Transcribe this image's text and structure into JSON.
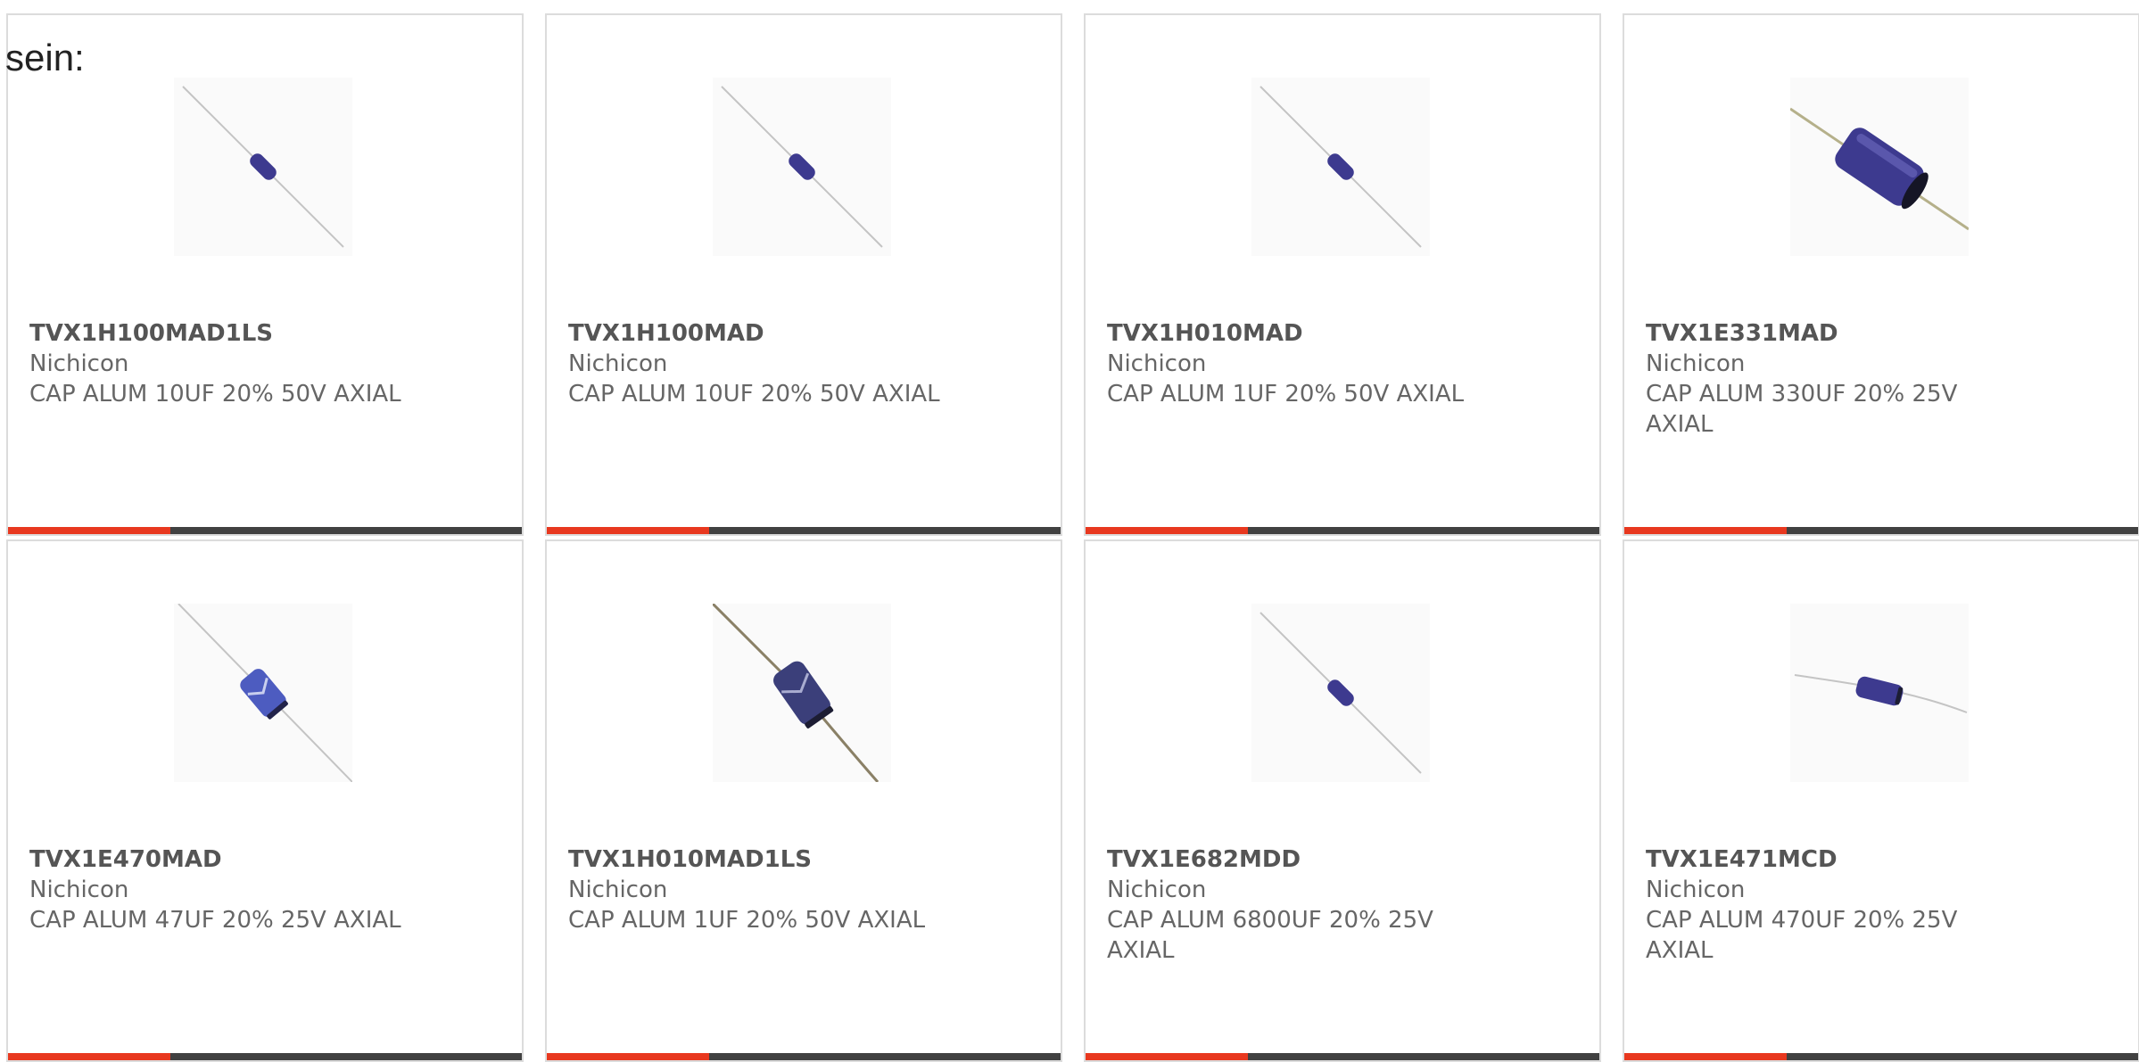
{
  "intro": {
    "text": "sein:"
  },
  "colors": {
    "accent": "#e8381f",
    "bar": "#414141",
    "border": "#dcdcdc",
    "capacitor": "#3d3a8f"
  },
  "products": [
    {
      "part_number": "TVX1H100MAD1LS",
      "manufacturer": "Nichicon",
      "description": "CAP ALUM 10UF 20% 50V AXIAL",
      "image": "capacitor-small-icon"
    },
    {
      "part_number": "TVX1H100MAD",
      "manufacturer": "Nichicon",
      "description": "CAP ALUM 10UF 20% 50V AXIAL",
      "image": "capacitor-small-icon"
    },
    {
      "part_number": "TVX1H010MAD",
      "manufacturer": "Nichicon",
      "description": "CAP ALUM 1UF 20% 50V AXIAL",
      "image": "capacitor-small-icon"
    },
    {
      "part_number": "TVX1E331MAD",
      "manufacturer": "Nichicon",
      "description": "CAP ALUM 330UF 20% 25V AXIAL",
      "image": "capacitor-large-icon"
    },
    {
      "part_number": "TVX1E470MAD",
      "manufacturer": "Nichicon",
      "description": "CAP ALUM 47UF 20% 25V AXIAL",
      "image": "capacitor-sleeved-icon"
    },
    {
      "part_number": "TVX1H010MAD1LS",
      "manufacturer": "Nichicon",
      "description": "CAP ALUM 1UF 20% 50V AXIAL",
      "image": "capacitor-sleeved-dark-icon"
    },
    {
      "part_number": "TVX1E682MDD",
      "manufacturer": "Nichicon",
      "description": "CAP ALUM 6800UF 20% 25V AXIAL",
      "image": "capacitor-small-icon"
    },
    {
      "part_number": "TVX1E471MCD",
      "manufacturer": "Nichicon",
      "description": "CAP ALUM 470UF 20% 25V AXIAL",
      "image": "capacitor-horizontal-icon"
    }
  ]
}
